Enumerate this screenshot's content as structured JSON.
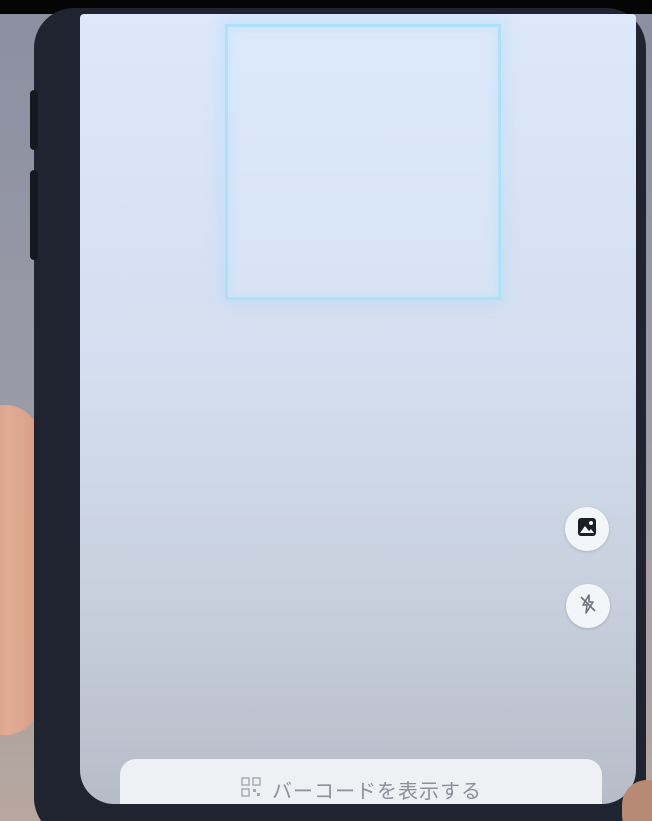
{
  "scanner": {
    "show_barcode_label": "バーコードを表示する"
  },
  "icons": {
    "gallery": "image-gallery-icon",
    "flash": "flash-off-icon",
    "qr": "qr-code-icon"
  },
  "colors": {
    "scan_frame": "#aee0f8",
    "screen_bg": "#dde8fb",
    "bar_bg": "#eef0f4",
    "label_text": "#8c9098"
  }
}
